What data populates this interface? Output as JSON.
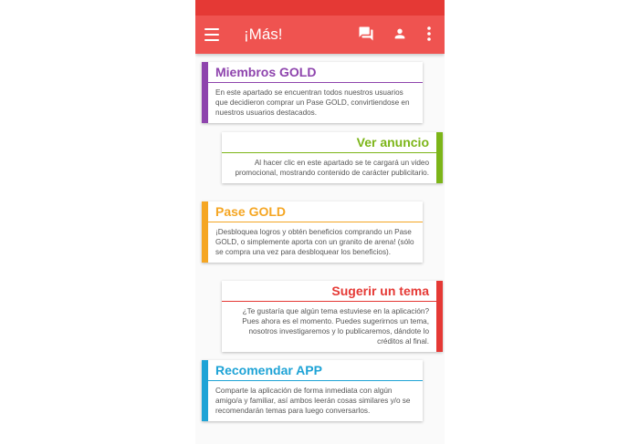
{
  "header": {
    "title": "¡Más!",
    "icons": [
      "menu-icon",
      "chat-icon",
      "person-icon",
      "more-vert-icon"
    ]
  },
  "colors": {
    "status_bar": "#e53935",
    "app_bar": "#ef5350",
    "purple": "#8e44ad",
    "green": "#7cb518",
    "amber": "#f5a623",
    "red": "#e53935",
    "blue": "#1ea3d6"
  },
  "cards": [
    {
      "title": "Miembros GOLD",
      "description": "En este apartado se encuentran todos nuestros usuarios que decidieron comprar un Pase GOLD, convirtiendose en nuestros usuarios destacados."
    },
    {
      "title": "Ver anuncio",
      "description": "Al hacer clic en este apartado se te cargará un video promocional, mostrando contenido de carácter publicitario."
    },
    {
      "title": "Pase GOLD",
      "description": "¡Desbloquea logros y obtén beneficios comprando un Pase GOLD, o simplemente aporta con un granito de arena! (sólo se compra una vez para desbloquear los beneficios)."
    },
    {
      "title": "Sugerir un tema",
      "description": "¿Te gustaría que algún tema estuviese en la aplicación? Pues ahora es el momento. Puedes sugerirnos un tema, nosotros investigaremos y lo publicaremos, dándote lo créditos al final."
    },
    {
      "title": "Recomendar APP",
      "description": "Comparte la aplicación de forma inmediata con algún amigo/a y familiar, así ambos leerán cosas similares y/o se recomendarán temas para luego conversarlos."
    }
  ]
}
